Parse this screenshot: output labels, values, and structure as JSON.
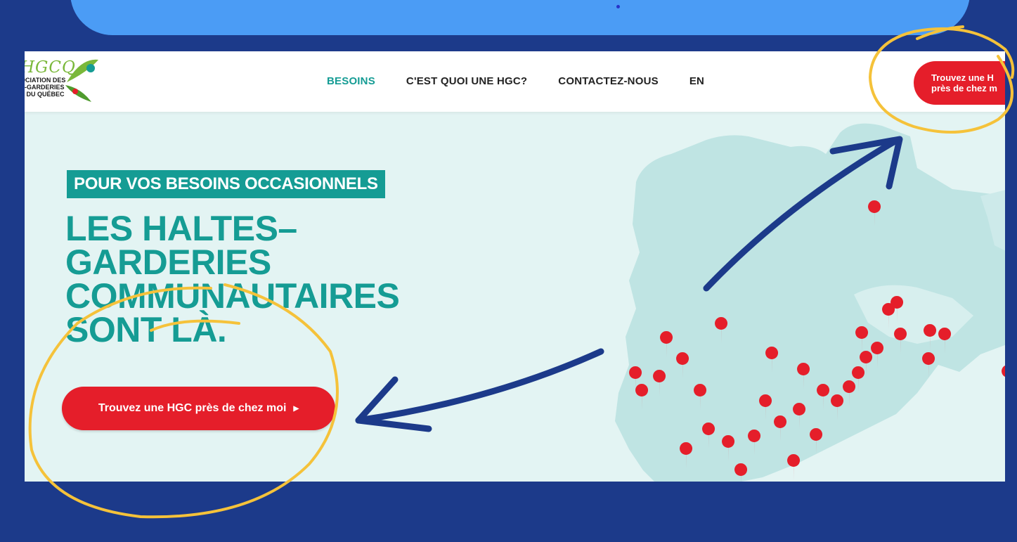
{
  "colors": {
    "background": "#1c3a8a",
    "banner": "#4b9cf5",
    "accent_teal": "#159c94",
    "cta_red": "#e51e2a",
    "annotation_yellow": "#f5c23a",
    "annotation_arrow": "#1c3a8a",
    "map_land": "#bfe4e3"
  },
  "logo": {
    "letters": "HGCQ",
    "lines": [
      "OCIATION DES",
      "S-GARDERIES",
      "S DU QUÉBEC"
    ]
  },
  "nav": {
    "items": [
      {
        "label": "BESOINS",
        "active": true
      },
      {
        "label": "C'EST QUOI UNE HGC?",
        "active": false
      },
      {
        "label": "CONTACTEZ-NOUS",
        "active": false
      },
      {
        "label": "EN",
        "active": false
      }
    ]
  },
  "header_cta": {
    "label": "Trouvez une H\nprès de chez m"
  },
  "hero": {
    "eyebrow": "POUR VOS BESOINS OCCASIONNELS",
    "headline_lines": [
      "LES HALTES–",
      "GARDERIES",
      "COMMUNAUTAIRES",
      "SONT LÀ."
    ],
    "cta_label": "Trouvez une HGC près de chez moi",
    "cta_icon": "caret-right-icon"
  },
  "map": {
    "marker_icon": "map-pin-icon"
  }
}
